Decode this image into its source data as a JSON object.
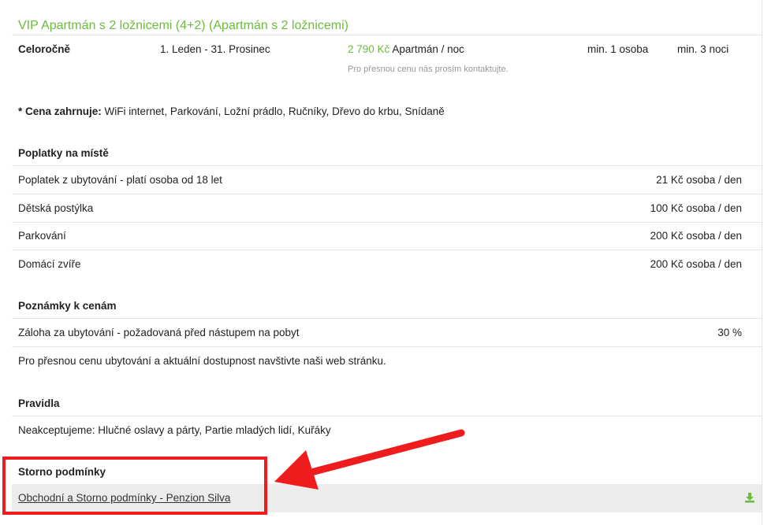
{
  "title": "VIP Apartmán s 2 ložnicemi (4+2) (Apartmán s 2 ložnicemi)",
  "season": {
    "name": "Celoročně",
    "dates": "1. Leden - 31. Prosinec",
    "price": "2 790 Kč",
    "unit": "Apartmán / noc",
    "min_persons": "min. 1 osoba",
    "min_nights": "min. 3 noci",
    "note": "Pro přesnou cenu nás prosím kontaktujte."
  },
  "includes": {
    "label": "* Cena zahrnuje:",
    "items": "WiFi internet, Parkování, Ložní prádlo, Ručníky, Dřevo do krbu, Snídaně"
  },
  "fees": {
    "heading": "Poplatky na místě",
    "rows": [
      {
        "name": "Poplatek z ubytování - platí osoba od 18 let",
        "value": "21 Kč osoba / den"
      },
      {
        "name": "Dětská postýlka",
        "value": "100 Kč osoba / den"
      },
      {
        "name": "Parkování",
        "value": "200 Kč osoba / den"
      },
      {
        "name": "Domácí zvíře",
        "value": "200 Kč osoba / den"
      }
    ]
  },
  "notes": {
    "heading": "Poznámky k cenám",
    "deposit_label": "Záloha za ubytování - požadovaná před nástupem na pobyt",
    "deposit_value": "30 %",
    "info": "Pro přesnou cenu ubytování a aktuální dostupnost navštivte naši web stránku."
  },
  "rules": {
    "heading": "Pravidla",
    "text": "Neakceptujeme: Hlučné oslavy a párty, Partie mladých lidí, Kuřáky"
  },
  "storno": {
    "heading": "Storno podmínky",
    "link": "Obchodní a Storno podmínky - Penzion Silva"
  },
  "colors": {
    "accent_green": "#6cbb3c",
    "highlight_red": "#ee1c1c",
    "row_bg": "#ececec"
  },
  "icons": {
    "download": "download-icon"
  }
}
